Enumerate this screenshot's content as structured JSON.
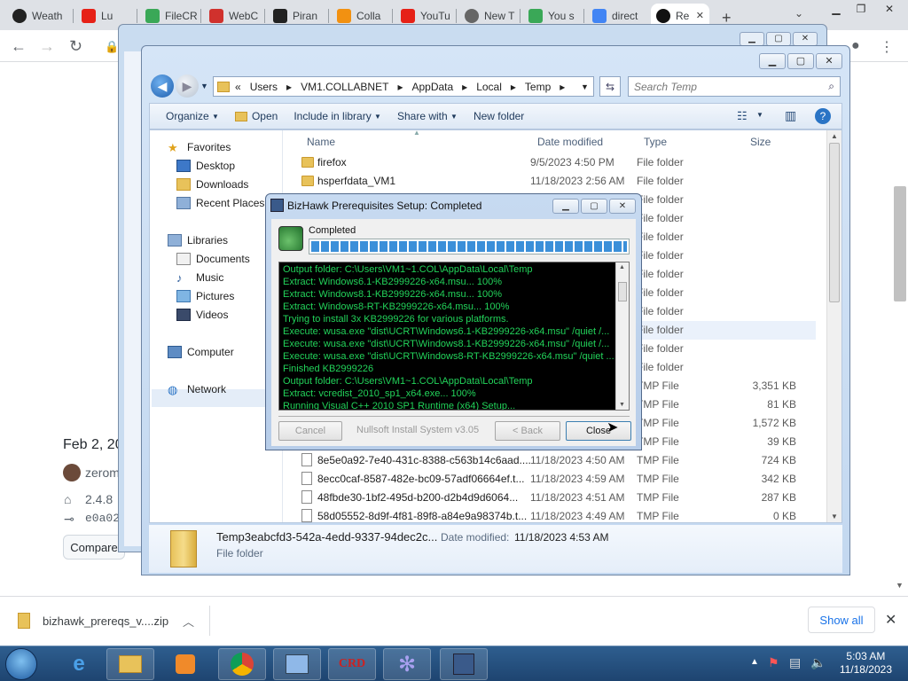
{
  "browser": {
    "tabs": [
      {
        "label": "Weath",
        "favicon": "circle-icon",
        "active": false
      },
      {
        "label": "Lu",
        "favicon": "youtube-icon",
        "active": false
      },
      {
        "label": "FileCR",
        "favicon": "filecr-icon",
        "active": false
      },
      {
        "label": "WebC",
        "favicon": "webcam-icon",
        "active": false
      },
      {
        "label": "Piran",
        "favicon": "piranha-icon",
        "active": false
      },
      {
        "label": "Colla",
        "favicon": "collab-icon",
        "active": false
      },
      {
        "label": "YouTu",
        "favicon": "youtube-icon",
        "active": false
      },
      {
        "label": "New T",
        "favicon": "chrome-icon",
        "active": false
      },
      {
        "label": "You s",
        "favicon": "filecr-icon",
        "active": false
      },
      {
        "label": "direct",
        "favicon": "google-icon",
        "active": false
      },
      {
        "label": "Re",
        "favicon": "github-icon",
        "active": true
      }
    ],
    "new_tab_glyph": "+",
    "page": {
      "date_text": "Feb 2, 20",
      "author": "zerom",
      "tag": "2.4.8",
      "commit": "e0a02",
      "compare_label": "Compare"
    },
    "download": {
      "filename": "bizhawk_prereqs_v....zip",
      "show_all": "Show all"
    }
  },
  "explorer": {
    "breadcrumb": [
      "«",
      "Users",
      "VM1.COLLABNET",
      "AppData",
      "Local",
      "Temp"
    ],
    "search_placeholder": "Search Temp",
    "commands": [
      "Organize",
      "Open",
      "Include in library",
      "Share with",
      "New folder"
    ],
    "nav": {
      "favorites": "Favorites",
      "favorites_items": [
        "Desktop",
        "Downloads",
        "Recent Places"
      ],
      "libraries": "Libraries",
      "libraries_items": [
        "Documents",
        "Music",
        "Pictures",
        "Videos"
      ],
      "computer": "Computer",
      "network": "Network"
    },
    "columns": {
      "name": "Name",
      "date": "Date modified",
      "type": "Type",
      "size": "Size"
    },
    "files": [
      {
        "name": "firefox",
        "date": "9/5/2023 4:50 PM",
        "type": "File folder",
        "size": "",
        "kind": "folder"
      },
      {
        "name": "hsperfdata_VM1",
        "date": "11/18/2023 2:56 AM",
        "type": "File folder",
        "size": "",
        "kind": "folder"
      },
      {
        "name": "",
        "date": "",
        "type": "File folder",
        "size": "",
        "kind": "folder"
      },
      {
        "name": "",
        "date": "",
        "type": "File folder",
        "size": "",
        "kind": "folder"
      },
      {
        "name": "",
        "date": "",
        "type": "File folder",
        "size": "",
        "kind": "folder"
      },
      {
        "name": "",
        "date": "",
        "type": "File folder",
        "size": "",
        "kind": "folder"
      },
      {
        "name": "",
        "date": "",
        "type": "File folder",
        "size": "",
        "kind": "folder"
      },
      {
        "name": "",
        "date": "",
        "type": "File folder",
        "size": "",
        "kind": "folder"
      },
      {
        "name": "",
        "date": "",
        "type": "File folder",
        "size": "",
        "kind": "folder"
      },
      {
        "name": "",
        "date": "",
        "type": "File folder",
        "size": "",
        "kind": "folder",
        "selected": true
      },
      {
        "name": "",
        "date": "",
        "type": "File folder",
        "size": "",
        "kind": "folder"
      },
      {
        "name": "",
        "date": "",
        "type": "File folder",
        "size": "",
        "kind": "folder"
      },
      {
        "name": "",
        "date": "",
        "type": "TMP File",
        "size": "3,351 KB",
        "kind": "file"
      },
      {
        "name": "",
        "date": "",
        "type": "TMP File",
        "size": "81 KB",
        "kind": "file"
      },
      {
        "name": "",
        "date": "",
        "type": "TMP File",
        "size": "1,572 KB",
        "kind": "file"
      },
      {
        "name": "",
        "date": "",
        "type": "TMP File",
        "size": "39 KB",
        "kind": "file"
      },
      {
        "name": "8e5e0a92-7e40-431c-8388-c563b14c6aad....",
        "date": "11/18/2023 4:50 AM",
        "type": "TMP File",
        "size": "724 KB",
        "kind": "file"
      },
      {
        "name": "8ecc0caf-8587-482e-bc09-57adf06664ef.t...",
        "date": "11/18/2023 4:59 AM",
        "type": "TMP File",
        "size": "342 KB",
        "kind": "file"
      },
      {
        "name": "48fbde30-1bf2-495d-b200-d2b4d9d6064...",
        "date": "11/18/2023 4:51 AM",
        "type": "TMP File",
        "size": "287 KB",
        "kind": "file"
      },
      {
        "name": "58d05552-8d9f-4f81-89f8-a84e9a98374b.t...",
        "date": "11/18/2023 4:49 AM",
        "type": "TMP File",
        "size": "0 KB",
        "kind": "file"
      }
    ],
    "details": {
      "name": "Temp3eabcfd3-542a-4edd-9337-94dec2c...",
      "date_label": "Date modified:",
      "date_value": "11/18/2023 4:53 AM",
      "type": "File folder"
    }
  },
  "installer": {
    "title": "BizHawk Prerequisites Setup: Completed",
    "status": "Completed",
    "progress": 1.0,
    "log": [
      "Output folder: C:\\Users\\VM1~1.COL\\AppData\\Local\\Temp",
      "Extract: Windows6.1-KB2999226-x64.msu... 100%",
      "Extract: Windows8.1-KB2999226-x64.msu... 100%",
      "Extract: Windows8-RT-KB2999226-x64.msu... 100%",
      "Trying to install 3x KB2999226 for various platforms.",
      "Execute: wusa.exe \"dist\\UCRT\\Windows6.1-KB2999226-x64.msu\" /quiet /...",
      "Execute: wusa.exe \"dist\\UCRT\\Windows8.1-KB2999226-x64.msu\" /quiet /...",
      "Execute: wusa.exe \"dist\\UCRT\\Windows8-RT-KB2999226-x64.msu\" /quiet ...",
      "Finished KB2999226",
      "Output folder: C:\\Users\\VM1~1.COL\\AppData\\Local\\Temp",
      "Extract: vcredist_2010_sp1_x64.exe... 100%",
      "Running Visual C++ 2010 SP1 Runtime (x64) Setup..."
    ],
    "buttons": {
      "cancel": "Cancel",
      "back": "< Back",
      "close": "Close"
    },
    "branding": "Nullsoft Install System v3.05"
  },
  "taskbar": {
    "time": "5:03 AM",
    "date": "11/18/2023"
  },
  "colors": {
    "console_text": "#22d35a",
    "progress_fill": "#3b8fd9",
    "taskbar": "#1e4470"
  }
}
